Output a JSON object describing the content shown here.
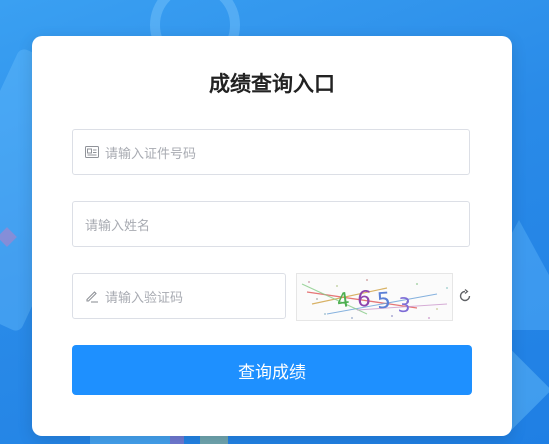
{
  "title": "成绩查询入口",
  "form": {
    "id_placeholder": "请输入证件号码",
    "name_placeholder": "请输入姓名",
    "code_placeholder": "请输入验证码",
    "captcha_text": "4653"
  },
  "submit_label": "查询成绩",
  "colors": {
    "primary": "#1e90ff",
    "border": "#dcdfe6",
    "placeholder": "#a8abb2",
    "background": "#2a8be8"
  },
  "icons": {
    "id_field": "id-card-icon",
    "code_field": "pencil-icon",
    "refresh": "refresh-icon"
  }
}
